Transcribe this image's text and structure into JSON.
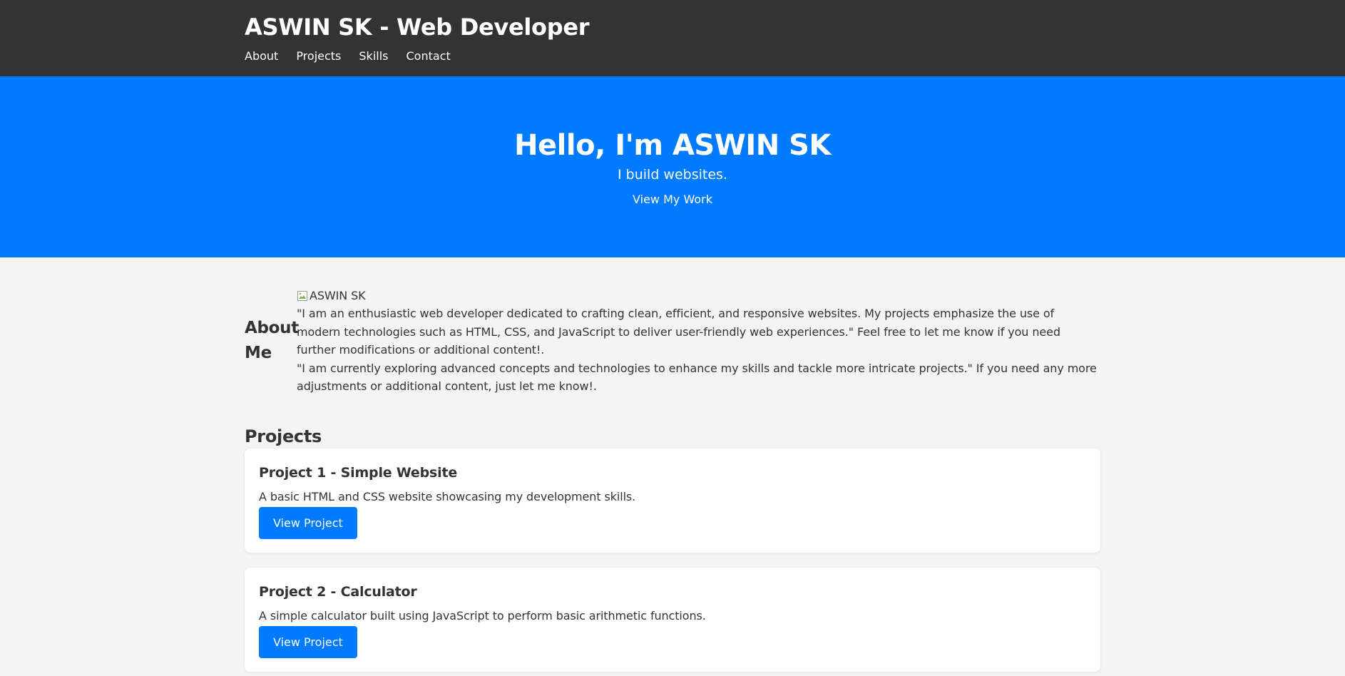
{
  "header": {
    "title": "ASWIN SK - Web Developer",
    "nav": [
      "About",
      "Projects",
      "Skills",
      "Contact"
    ]
  },
  "hero": {
    "heading": "Hello, I'm ASWIN SK",
    "tagline": "I build websites.",
    "cta": "View My Work"
  },
  "about": {
    "heading": "About Me",
    "image_alt": "ASWIN SK",
    "paragraphs": [
      "\"I am an enthusiastic web developer dedicated to crafting clean, efficient, and responsive websites. My projects emphasize the use of modern technologies such as HTML, CSS, and JavaScript to deliver user-friendly web experiences.\" Feel free to let me know if you need further modifications or additional content!.",
      "\"I am currently exploring advanced concepts and technologies to enhance my skills and tackle more intricate projects.\" If you need any more adjustments or additional content, just let me know!."
    ]
  },
  "projects": {
    "heading": "Projects",
    "items": [
      {
        "title": "Project 1 - Simple Website",
        "description": "A basic HTML and CSS website showcasing my development skills.",
        "button": "View Project"
      },
      {
        "title": "Project 2 - Calculator",
        "description": "A simple calculator built using JavaScript to perform basic arithmetic functions.",
        "button": "View Project"
      }
    ]
  },
  "colors": {
    "header_bg": "#333333",
    "hero_bg": "#007bff",
    "page_bg": "#f4f4f4",
    "accent": "#007bff"
  }
}
